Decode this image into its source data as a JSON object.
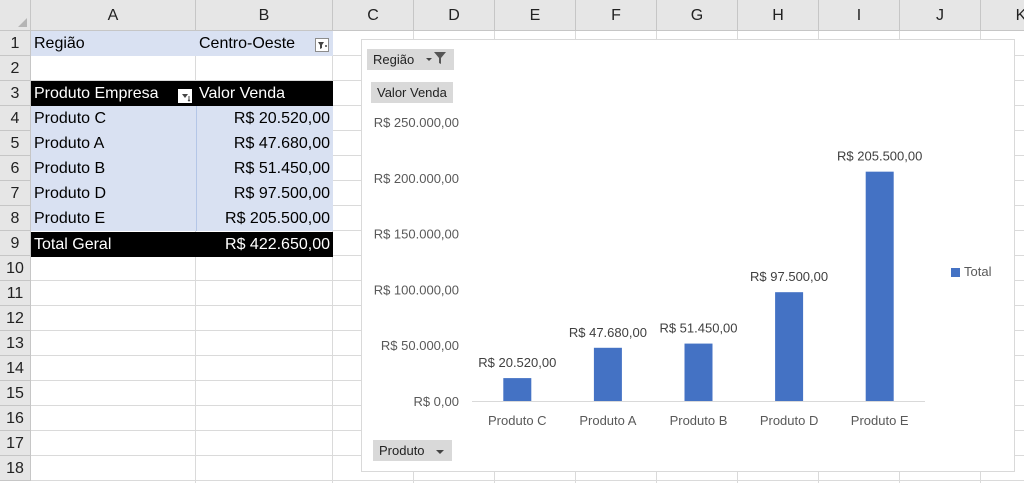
{
  "columns": [
    "A",
    "B",
    "C",
    "D",
    "E",
    "F",
    "G",
    "H",
    "I",
    "J",
    "K"
  ],
  "rows": [
    "1",
    "2",
    "3",
    "4",
    "5",
    "6",
    "7",
    "8",
    "9",
    "10",
    "11",
    "12",
    "13",
    "14",
    "15",
    "16",
    "17",
    "18"
  ],
  "pivot": {
    "filter_label": "Região",
    "filter_value": "Centro-Oeste",
    "header_row_label": "Produto Empresa",
    "header_value_label": "Valor Venda",
    "items": [
      {
        "label": "Produto C",
        "value": "R$ 20.520,00"
      },
      {
        "label": "Produto A",
        "value": "R$ 47.680,00"
      },
      {
        "label": "Produto B",
        "value": "R$ 51.450,00"
      },
      {
        "label": "Produto D",
        "value": "R$ 97.500,00"
      },
      {
        "label": "Produto E",
        "value": "R$ 205.500,00"
      }
    ],
    "total_label": "Total Geral",
    "total_value": "R$ 422.650,00"
  },
  "chart": {
    "filter_button_label": "Região",
    "value_button_label": "Valor Venda",
    "axis_button_label": "Produto",
    "legend_label": "Total",
    "bar_color": "#4472c4"
  },
  "chart_data": {
    "type": "bar",
    "categories": [
      "Produto C",
      "Produto A",
      "Produto B",
      "Produto D",
      "Produto E"
    ],
    "series": [
      {
        "name": "Total",
        "values": [
          20520,
          47680,
          51450,
          97500,
          205500
        ]
      }
    ],
    "data_labels": [
      "R$ 20.520,00",
      "R$ 47.680,00",
      "R$ 51.450,00",
      "R$ 97.500,00",
      "R$ 205.500,00"
    ],
    "ylim": [
      0,
      250000
    ],
    "yticks": [
      0,
      50000,
      100000,
      150000,
      200000,
      250000
    ],
    "ytick_labels": [
      "R$ 0,00",
      "R$ 50.000,00",
      "R$ 100.000,00",
      "R$ 150.000,00",
      "R$ 200.000,00",
      "R$ 250.000,00"
    ],
    "grid": false,
    "legend": "right"
  }
}
